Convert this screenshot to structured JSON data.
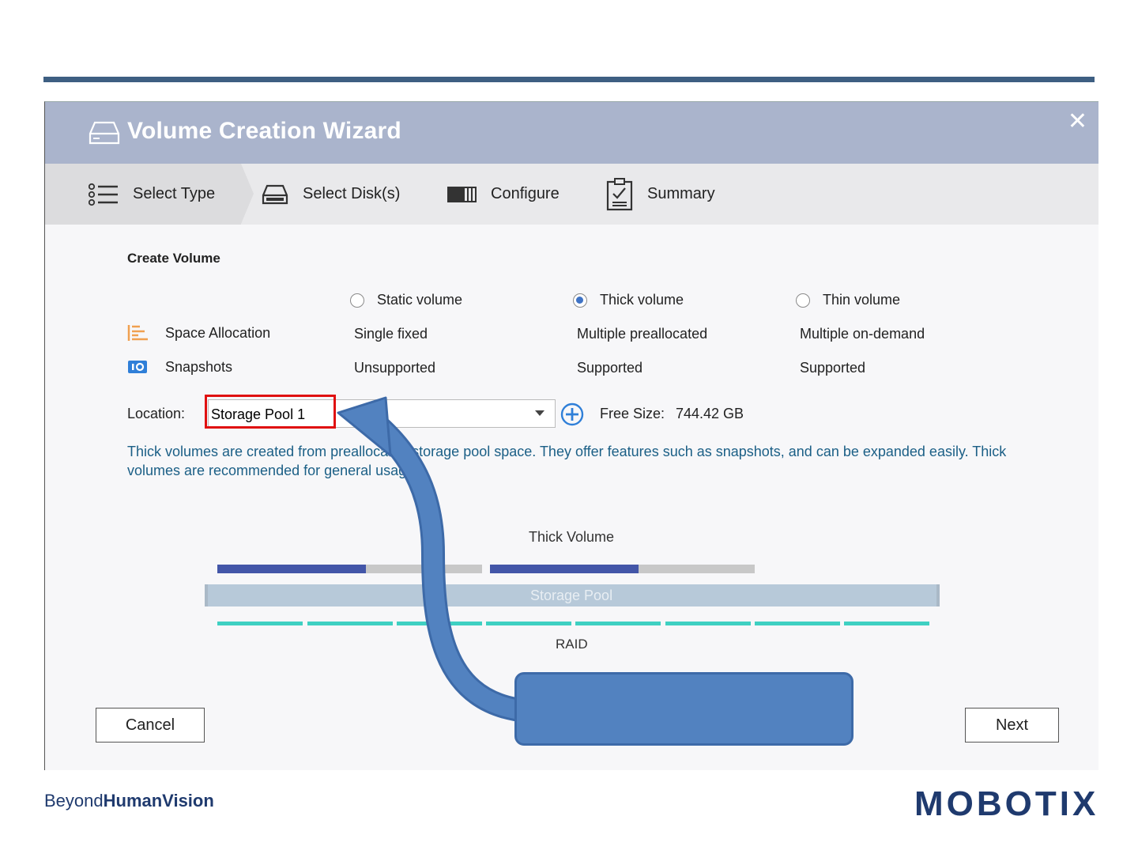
{
  "wizard": {
    "title": "Volume Creation Wizard",
    "close_symbol": "✕",
    "steps": [
      {
        "label": "Select Type",
        "icon": "list-icon",
        "active": true
      },
      {
        "label": "Select Disk(s)",
        "icon": "disk-drive-icon",
        "active": false
      },
      {
        "label": "Configure",
        "icon": "configure-icon",
        "active": false
      },
      {
        "label": "Summary",
        "icon": "clipboard-check-icon",
        "active": false
      }
    ]
  },
  "create_volume": {
    "title": "Create Volume",
    "options": [
      {
        "label": "Static volume",
        "selected": false,
        "space": "Single fixed",
        "snapshots": "Unsupported"
      },
      {
        "label": "Thick volume",
        "selected": true,
        "space": "Multiple preallocated",
        "snapshots": "Supported"
      },
      {
        "label": "Thin volume",
        "selected": false,
        "space": "Multiple on-demand",
        "snapshots": "Supported"
      }
    ],
    "rows": {
      "space_allocation": "Space Allocation",
      "snapshots": "Snapshots"
    },
    "location_label": "Location:",
    "location_value": "Storage Pool 1",
    "free_size_label": "Free Size:",
    "free_size_value": "744.42 GB",
    "description": "Thick volumes are created from preallocated storage pool space. They offer features such as snapshots, and can be expanded easily. Thick volumes are recommended for general usage."
  },
  "diagram": {
    "title": "Thick Volume",
    "pool_label": "Storage Pool",
    "raid_label": "RAID",
    "volumes": [
      {
        "used_fraction": 0.56
      },
      {
        "used_fraction": 0.56
      }
    ],
    "colors": {
      "used": "#4356a8",
      "free": "#c8c8c8",
      "raid": "#3fd0c2"
    }
  },
  "buttons": {
    "cancel": "Cancel",
    "next": "Next"
  },
  "footer": {
    "tagline_light": "Beyond",
    "tagline_bold": "HumanVision",
    "logo": "MOBOTIX"
  },
  "colors": {
    "accent": "#3e5f82",
    "callout": "#5282c0",
    "highlight": "#e01010",
    "desc_text": "#1b5f86"
  }
}
